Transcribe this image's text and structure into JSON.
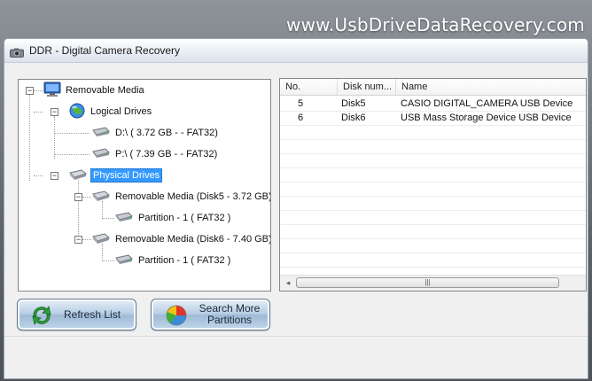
{
  "banner": {
    "text": "www.UsbDriveDataRecovery.com"
  },
  "window": {
    "title": "DDR - Digital Camera Recovery"
  },
  "tree": {
    "root": "Removable Media",
    "logical": "Logical Drives",
    "drive_d": "D:\\ (  3.72 GB  -  - FAT32)",
    "drive_p": "P:\\ (  7.39 GB  -  - FAT32)",
    "physical": "Physical Drives",
    "disk5": "Removable Media (Disk5 - 3.72 GB)",
    "disk5_part": "Partition - 1 ( FAT32 )",
    "disk6": "Removable Media (Disk6 - 7.40 GB)",
    "disk6_part": "Partition - 1 ( FAT32 )"
  },
  "list": {
    "columns": [
      "No.",
      "Disk num...",
      "Name"
    ],
    "rows": [
      {
        "no": "5",
        "disk": "Disk5",
        "name": "CASIO DIGITAL_CAMERA USB Device"
      },
      {
        "no": "6",
        "disk": "Disk6",
        "name": "USB Mass  Storage Device USB Device"
      }
    ]
  },
  "buttons": {
    "refresh": "Refresh List",
    "search_line1": "Search More",
    "search_line2": "Partitions"
  },
  "icons": {
    "app": "camera-icon",
    "root": "monitor-icon",
    "logical": "globe-icon",
    "drive": "usb-drive-icon",
    "physical": "disk-icon",
    "refresh": "refresh-arrows-icon",
    "search": "pie-chart-icon"
  }
}
